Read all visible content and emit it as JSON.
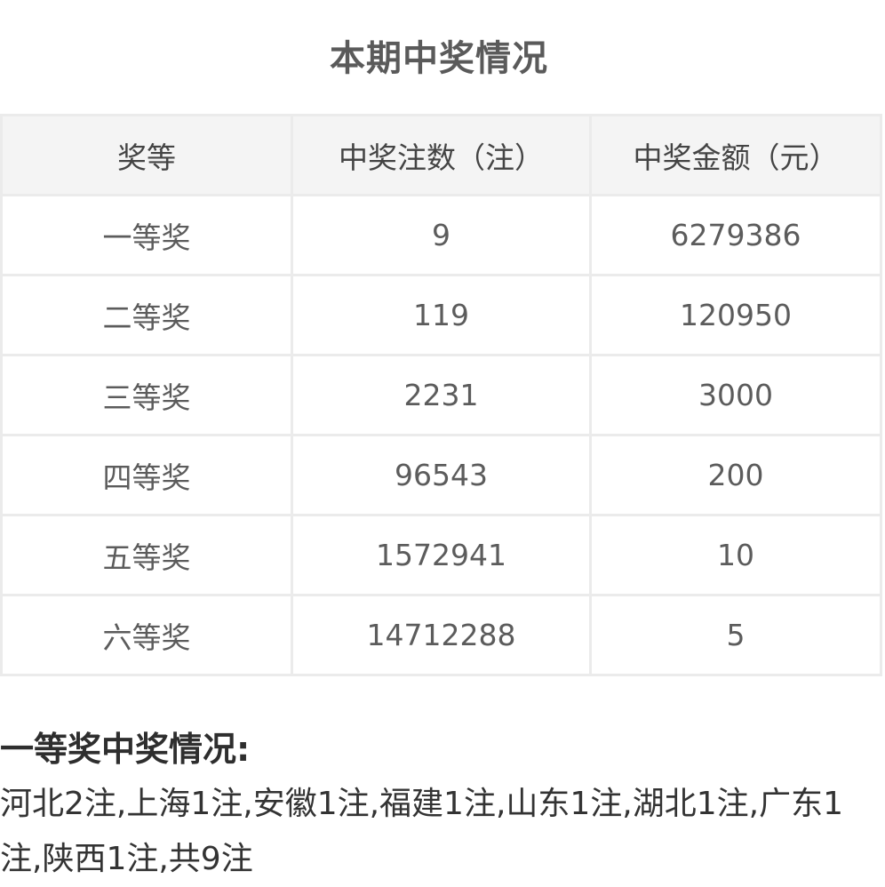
{
  "title": "本期中奖情况",
  "table": {
    "headers": [
      "奖等",
      "中奖注数（注）",
      "中奖金额（元）"
    ],
    "rows": [
      [
        "一等奖",
        "9",
        "6279386"
      ],
      [
        "二等奖",
        "119",
        "120950"
      ],
      [
        "三等奖",
        "2231",
        "3000"
      ],
      [
        "四等奖",
        "96543",
        "200"
      ],
      [
        "五等奖",
        "1572941",
        "10"
      ],
      [
        "六等奖",
        "14712288",
        "5"
      ]
    ]
  },
  "first_prize": {
    "heading": "一等奖中奖情况:",
    "detail": "河北2注,上海1注,安徽1注,福建1注,山东1注,湖北1注,广东1注,陕西1注,共9注"
  },
  "colors": {
    "header_bg": "#f4f4f4",
    "border": "#ebebeb",
    "text": "#5c5c5c",
    "heading_text": "#2e2e2e"
  }
}
